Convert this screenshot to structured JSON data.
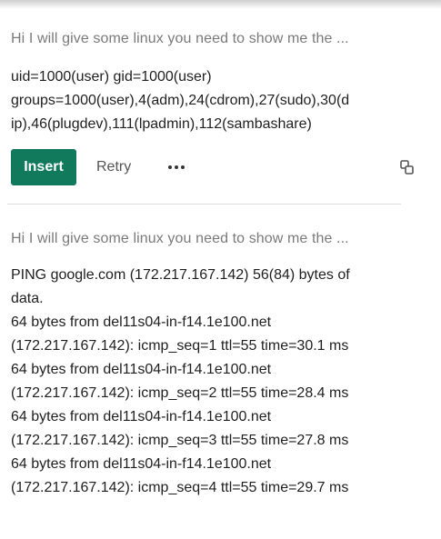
{
  "messages": [
    {
      "prompt": "Hi I will give some linux you need to show me the ...",
      "response_lines": [
        "uid=1000(user) gid=1000(user)",
        "groups=1000(user),4(adm),24(cdrom),27(sudo),30(d",
        "ip),46(plugdev),111(lpadmin),112(sambashare)"
      ]
    },
    {
      "prompt": "Hi I will give some linux you need to show me the ...",
      "response_lines": [
        "PING google.com (172.217.167.142) 56(84) bytes of",
        "data.",
        "64 bytes from del11s04-in-f14.1e100.net",
        "(172.217.167.142): icmp_seq=1 ttl=55 time=30.1 ms",
        "64 bytes from del11s04-in-f14.1e100.net",
        "(172.217.167.142): icmp_seq=2 ttl=55 time=28.4 ms",
        "64 bytes from del11s04-in-f14.1e100.net",
        "(172.217.167.142): icmp_seq=3 ttl=55 time=27.8 ms",
        "64 bytes from del11s04-in-f14.1e100.net",
        "(172.217.167.142): icmp_seq=4 ttl=55 time=29.7 ms"
      ]
    }
  ],
  "actions": {
    "insert_label": "Insert",
    "retry_label": "Retry",
    "more_icon": "more-horizontal-icon",
    "copy_icon": "copy-icon"
  },
  "colors": {
    "accent": "#127a5c",
    "prompt_text": "#7a7a7a",
    "body_text": "#1f1f1f",
    "divider": "#dedede"
  }
}
